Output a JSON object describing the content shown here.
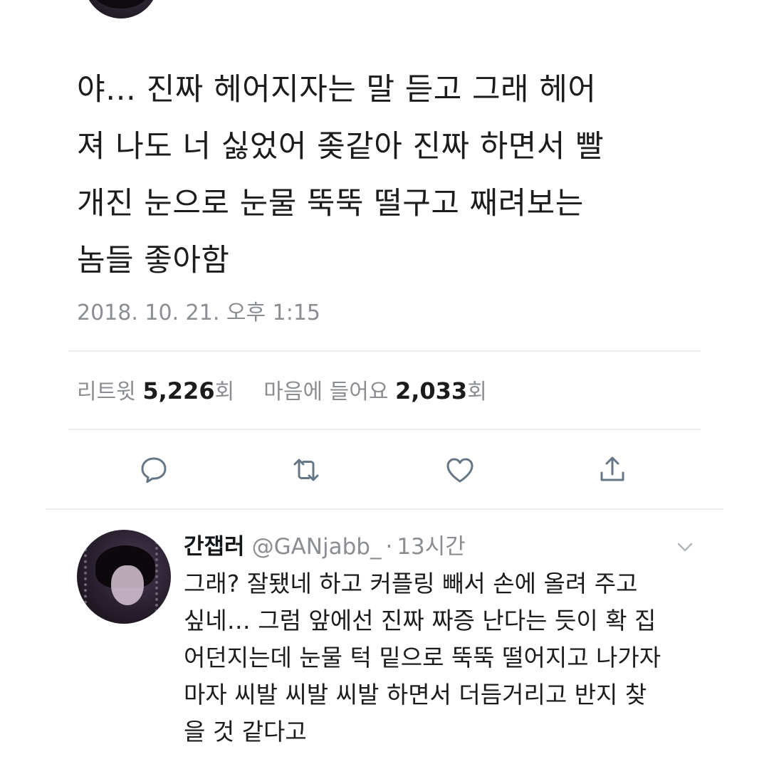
{
  "tweet": {
    "text_lines": [
      "야… 진짜 헤어지자는 말 듣고 그래 헤어",
      "져 나도 너 싫었어 좆같아 진짜 하면서 빨",
      "개진 눈으로 눈물 뚝뚝 떨구고 째려보는",
      "놈들 좋아함"
    ],
    "timestamp": "2018. 10. 21. 오후 1:15",
    "stats": {
      "retweets_label": "리트윗",
      "retweets_count": "5,226",
      "retweets_unit": "회",
      "likes_label": "마음에 들어요",
      "likes_count": "2,033",
      "likes_unit": "회"
    },
    "actions": [
      {
        "icon": "reply-icon"
      },
      {
        "icon": "retweet-icon"
      },
      {
        "icon": "heart-icon"
      },
      {
        "icon": "share-icon"
      }
    ]
  },
  "reply": {
    "name": "간잽러",
    "handle": "@GANjabb_",
    "separator": "·",
    "time": "13시간",
    "text_lines": [
      "그래? 잘됐네 하고 커플링 빼서 손에 올려 주고",
      "싶네… 그럼 앞에선 진짜 짜증 난다는 듯이 확 집",
      "어던지는데 눈물 턱 밑으로 뚝뚝 떨어지고 나가자",
      "마자 씨발 씨발 씨발 하면서 더듬거리고 반지 찾",
      "을 것 같다고"
    ]
  },
  "colors": {
    "text_primary": "#1c1c1c",
    "text_secondary": "#8a8d91",
    "divider": "#e6ecf0",
    "icon": "#657786"
  }
}
